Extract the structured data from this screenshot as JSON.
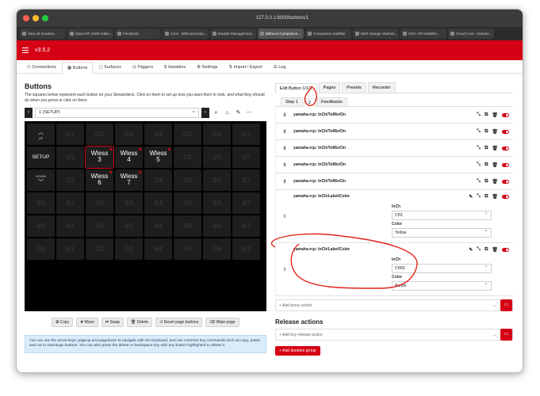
{
  "browser": {
    "url": "127.0.0.1:8000/buttons/1",
    "tabs": [
      "View all snackeo...",
      "OpenAPI JSON Edito...",
      "Facebook",
      "3.5.5 · bitfocus/comp...",
      "Module Management...",
      "Bitfocus Companion...",
      "Companion Satellite",
      "DM7 change channel...",
      "OSC: RP-Satellite...",
      "Cloud Core › Downlo..."
    ],
    "active_tab_index": 5
  },
  "app": {
    "version": "v3.5.2",
    "nav_tabs": [
      "Connections",
      "Buttons",
      "Surfaces",
      "Triggers",
      "Variables",
      "Settings",
      "Import / Export",
      "Log"
    ],
    "active_nav_index": 1,
    "accent": "#d50215"
  },
  "buttons": {
    "title": "Buttons",
    "description": "The squares below represent each button on your Streamdeck. Click on them to set up how you want them to look, and what they should do when you press or click on them.",
    "page_select": "1 (SETUP)",
    "grid": [
      [
        {
          "t": "UP",
          "s": "up"
        },
        {
          "t": "0/1"
        },
        {
          "t": "0/2"
        },
        {
          "t": "0/3"
        },
        {
          "t": "0/4"
        },
        {
          "t": "0/5"
        },
        {
          "t": "0/6"
        },
        {
          "t": "0/7"
        }
      ],
      [
        {
          "t": "SETUP",
          "w": 1
        },
        {
          "t": "1/1"
        },
        {
          "t": "Wless\n3",
          "w": 1,
          "sel": 1
        },
        {
          "t": "Wless\n4",
          "w": 1
        },
        {
          "t": "Wless\n5",
          "w": 1
        },
        {
          "t": "1/5"
        },
        {
          "t": "1/6"
        },
        {
          "t": "1/7"
        }
      ],
      [
        {
          "t": "DOWN",
          "s": "down"
        },
        {
          "t": "2/1"
        },
        {
          "t": "Wless\n6",
          "w": 1
        },
        {
          "t": "Wless\n7",
          "w": 1
        },
        {
          "t": "2/4"
        },
        {
          "t": "2/5"
        },
        {
          "t": "2/6"
        },
        {
          "t": "2/7"
        }
      ],
      [
        {
          "t": "3/0"
        },
        {
          "t": "3/1"
        },
        {
          "t": "3/2"
        },
        {
          "t": "3/3"
        },
        {
          "t": "3/4"
        },
        {
          "t": "3/5"
        },
        {
          "t": "3/6"
        },
        {
          "t": "3/7"
        }
      ],
      [
        {
          "t": "4/0"
        },
        {
          "t": "4/1"
        },
        {
          "t": "4/2"
        },
        {
          "t": "4/3"
        },
        {
          "t": "4/4"
        },
        {
          "t": "4/5"
        },
        {
          "t": "4/6"
        },
        {
          "t": "4/7"
        }
      ],
      [
        {
          "t": "5/0"
        },
        {
          "t": "5/1"
        },
        {
          "t": "5/2"
        },
        {
          "t": "5/3"
        },
        {
          "t": "5/4"
        },
        {
          "t": "5/5"
        },
        {
          "t": "5/6"
        },
        {
          "t": "5/7"
        }
      ]
    ],
    "actions": [
      "Copy",
      "Move",
      "Swap",
      "Delete",
      "Reset page buttons",
      "Wipe page"
    ],
    "info": "You can use the arrow keys, pageup and pagedown to navigate with the keyboard, and use common key commands such as copy, paste, and cut to rearrange buttons. You can also press the delete or backspace key with any button highlighted to delete it."
  },
  "editor": {
    "tabs": [
      "Edit Button 1/1/2",
      "Pages",
      "Presets",
      "Recorder"
    ],
    "step_tabs": [
      "Step 1",
      "2",
      "Feedbacks"
    ],
    "simple_actions": [
      "yamaha-rcp: InCh/ToMix/On",
      "yamaha-rcp: InCh/ToMix/On",
      "yamaha-rcp: InCh/ToMix/On",
      "yamaha-rcp: InCh/ToMix/On",
      "yamaha-rcp: InCh/ToMix/On"
    ],
    "label_actions": [
      {
        "name": "yamaha-rcp: InCh/Label/Color",
        "inch_label": "InCh",
        "inch": "CH1",
        "color_label": "Color",
        "color": "Yellow"
      },
      {
        "name": "yamaha-rcp: InCh/Label/Color",
        "inch_label": "InCh",
        "inch": "CH65",
        "color_label": "Color",
        "color": "Purple"
      }
    ],
    "add_press_action": "+ Add press action",
    "release_heading": "Release actions",
    "add_release_action": "+ Add key release action",
    "add_duration_group": "+ Add duration group"
  }
}
